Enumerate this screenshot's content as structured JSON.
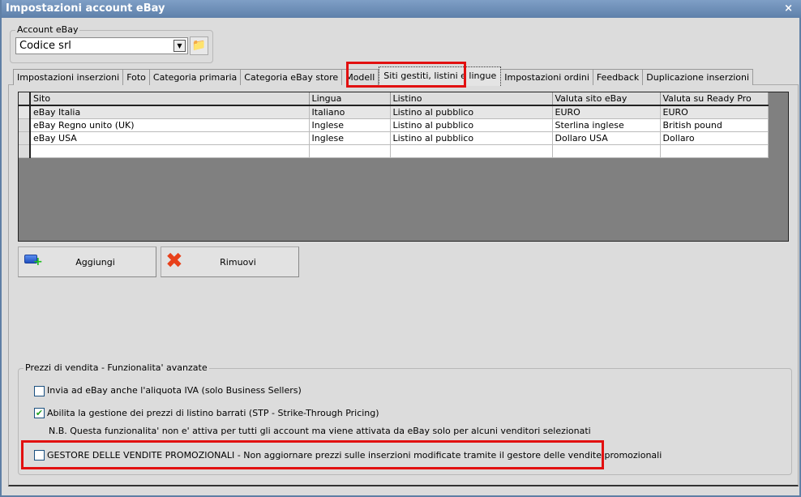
{
  "window": {
    "title": "Impostazioni account eBay",
    "close": "×"
  },
  "account": {
    "group_label": "Account eBay",
    "selected": "Codice srl"
  },
  "tabs": [
    "Impostazioni inserzioni",
    "Foto",
    "Categoria primaria",
    "Categoria eBay store",
    "Modell",
    "Siti gestiti, listini e lingue",
    "Impostazioni ordini",
    "Feedback",
    "Duplicazione inserzioni"
  ],
  "active_tab": "Siti gestiti, listini e lingue",
  "grid": {
    "columns": [
      "Sito",
      "Lingua",
      "Listino",
      "Valuta sito eBay",
      "Valuta su Ready Pro"
    ],
    "rows": [
      [
        "eBay Italia",
        "Italiano",
        "Listino al pubblico",
        "EURO",
        "EURO"
      ],
      [
        "eBay Regno unito (UK)",
        "Inglese",
        "Listino al pubblico",
        "Sterlina inglese",
        "British pound"
      ],
      [
        "eBay USA",
        "Inglese",
        "Listino al pubblico",
        "Dollaro USA",
        "Dollaro"
      ]
    ]
  },
  "buttons": {
    "add": "Aggiungi",
    "remove": "Rimuovi"
  },
  "prices": {
    "group_label": "Prezzi di vendita - Funzionalita' avanzate",
    "vat": {
      "label": "Invia ad eBay anche l'aliquota IVA (solo Business Sellers)",
      "checked": false
    },
    "stp": {
      "label": "Abilita la gestione dei prezzi di listino barrati (STP - Strike-Through Pricing)",
      "checked": true
    },
    "note": "N.B. Questa funzionalita' non e' attiva per tutti gli account ma viene attivata da eBay solo per alcuni venditori selezionati",
    "promo": {
      "label": "GESTORE DELLE VENDITE PROMOZIONALI - Non aggiornare prezzi sulle inserzioni modificate tramite il gestore delle vendite promozionali",
      "checked": false
    }
  },
  "colors": {
    "highlight": "#e21010",
    "titlebar": "#6b8db5"
  }
}
